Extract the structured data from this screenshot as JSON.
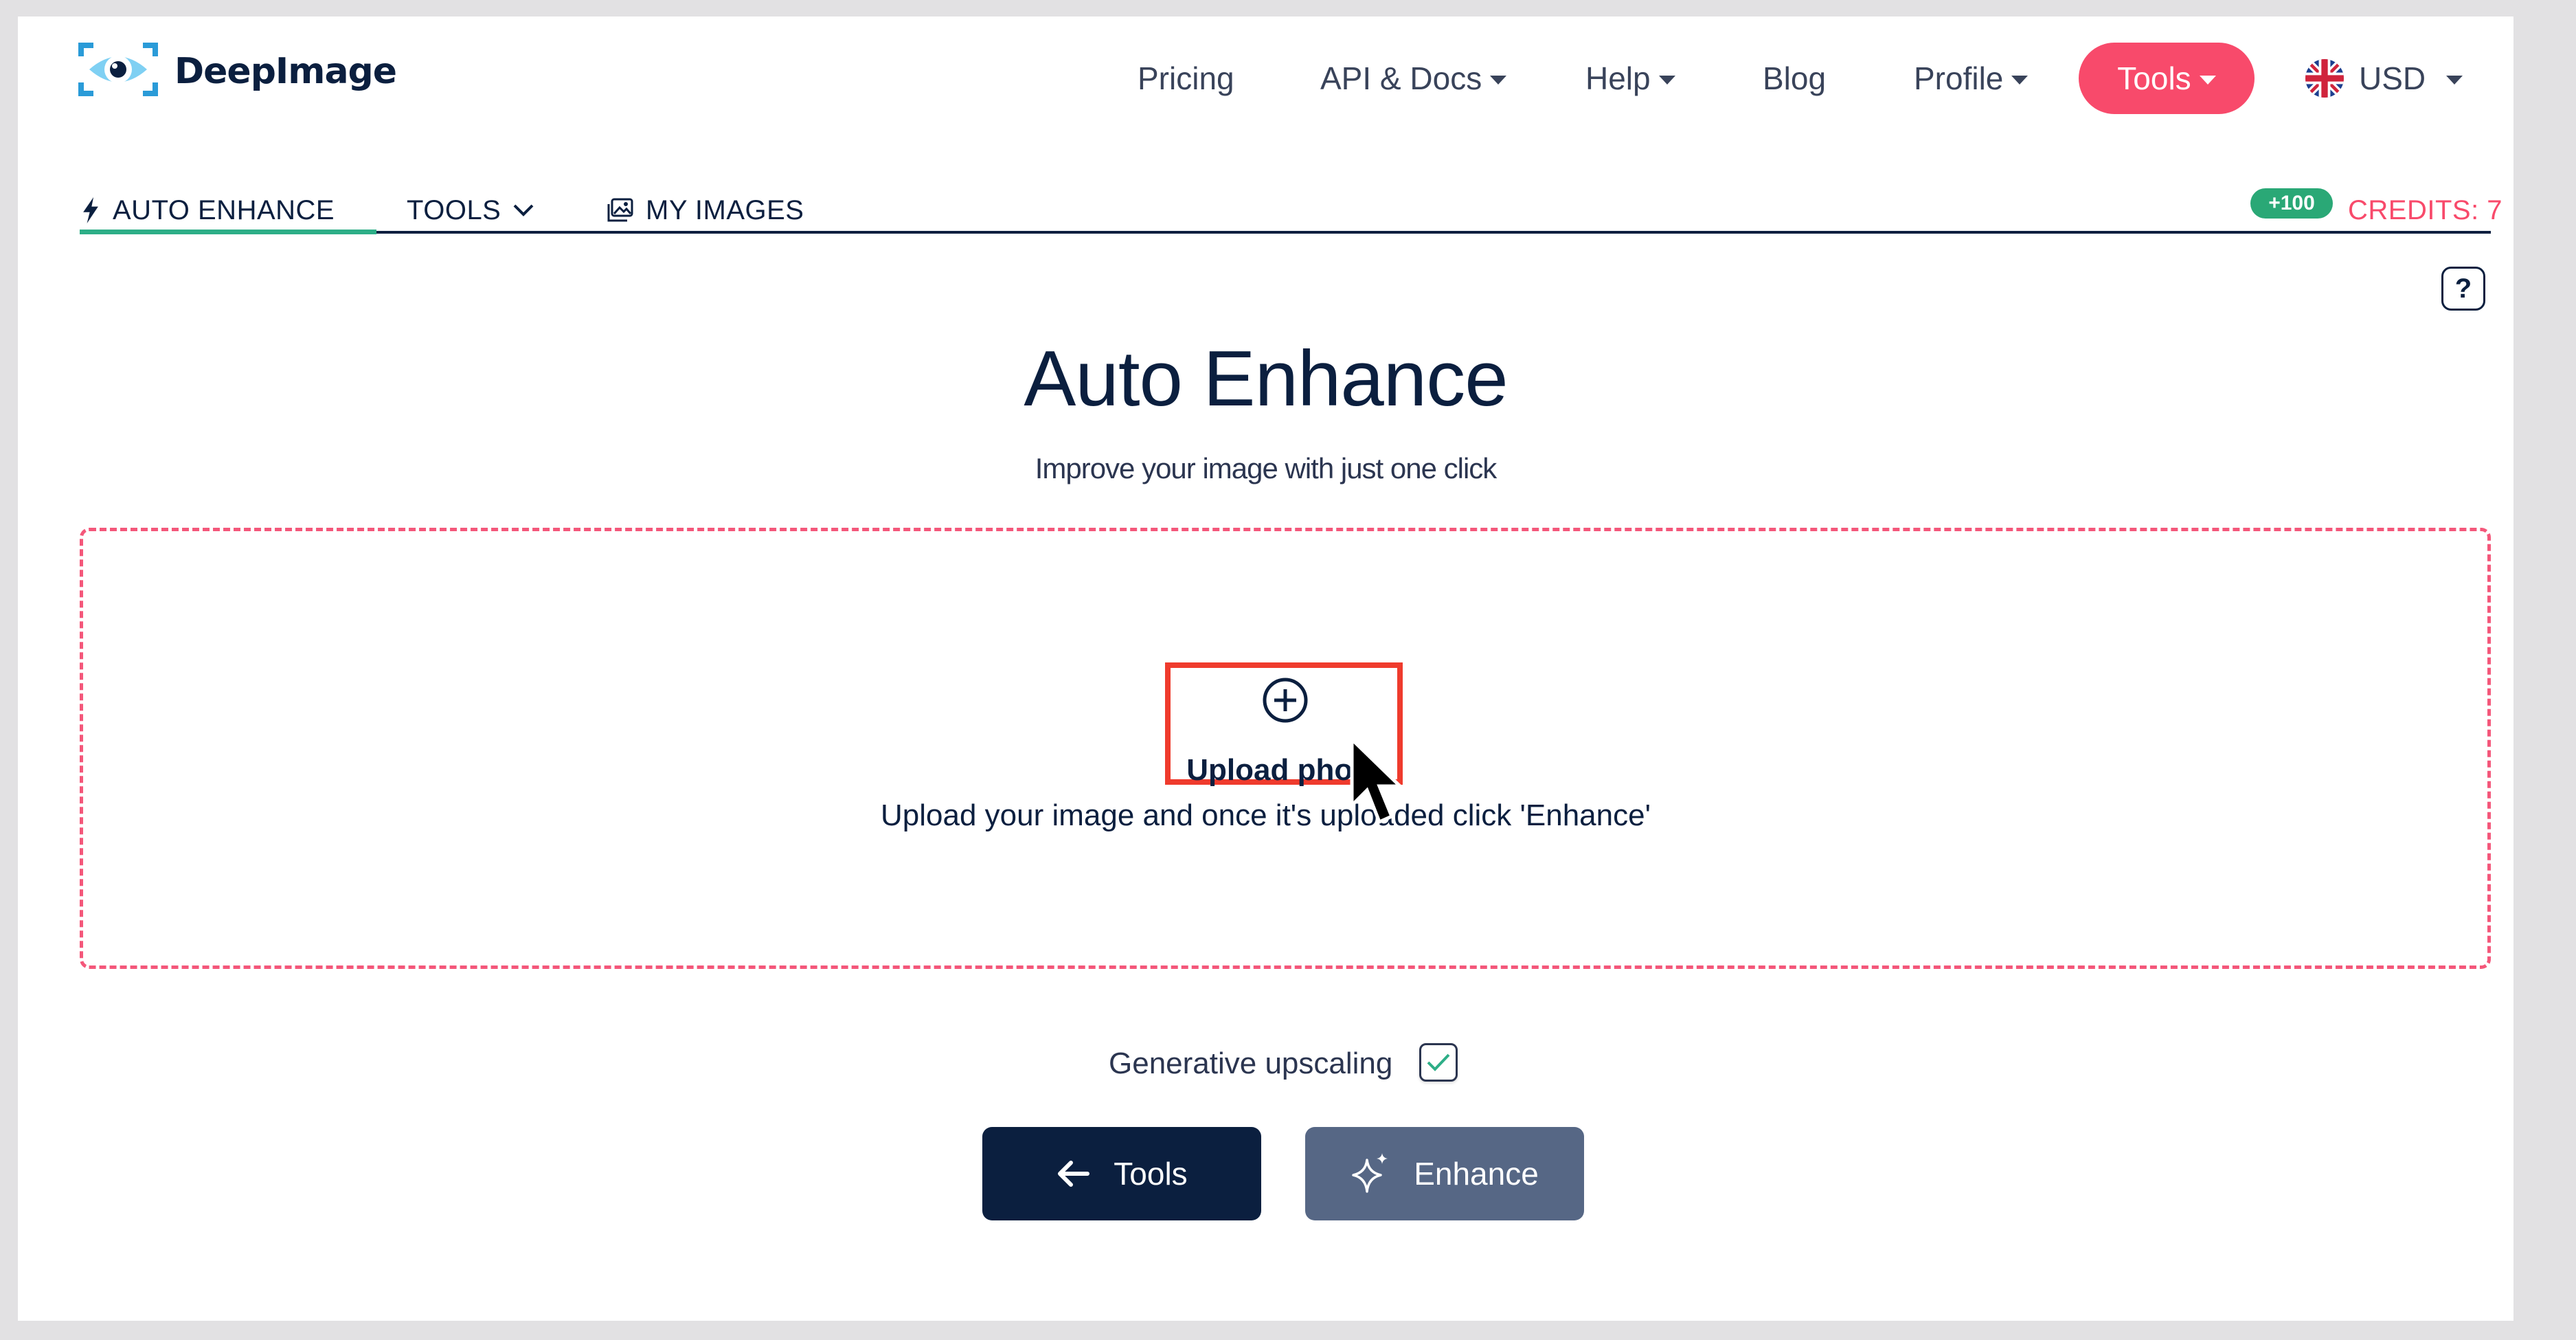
{
  "brand": {
    "name": "DeepImage",
    "accent": "#f84a6b",
    "navy": "#0b1f3f",
    "green": "#2dae87"
  },
  "nav": {
    "pricing": "Pricing",
    "api_docs": "API & Docs",
    "help": "Help",
    "blog": "Blog",
    "profile": "Profile",
    "tools": "Tools",
    "currency": "USD"
  },
  "tabs": {
    "auto_enhance": "AUTO ENHANCE",
    "tools": "TOOLS",
    "my_images": "MY IMAGES"
  },
  "credits": {
    "bonus": "+100",
    "label": "CREDITS: 7"
  },
  "help_button": "?",
  "heading": {
    "title": "Auto Enhance",
    "subtitle": "Improve your image with just one click"
  },
  "dropzone": {
    "upload_label": "Upload photo",
    "hint": "Upload your image and once it's uploaded click 'Enhance'"
  },
  "options": {
    "generative_upscaling_label": "Generative upscaling",
    "generative_upscaling_checked": true
  },
  "buttons": {
    "tools": "Tools",
    "enhance": "Enhance"
  },
  "icons": {
    "logo": "eye-logo-icon",
    "flag": "uk-flag-icon",
    "bolt": "bolt-icon",
    "images": "images-icon",
    "chevron": "chevron-down-icon",
    "plus": "plus-circle-icon",
    "check": "check-icon",
    "arrow": "arrow-left-icon",
    "sparkle": "sparkle-icon",
    "cursor": "mouse-cursor-icon"
  }
}
